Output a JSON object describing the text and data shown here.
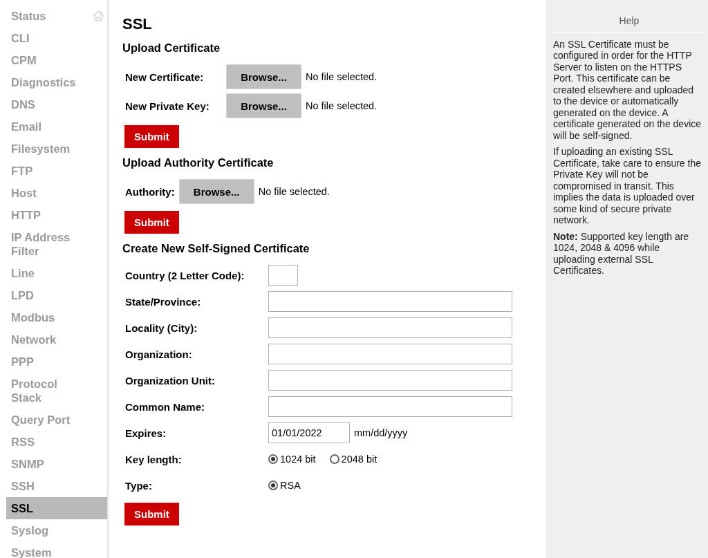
{
  "sidebar": {
    "items": [
      {
        "label": "Status",
        "selected": false
      },
      {
        "label": "CLI",
        "selected": false
      },
      {
        "label": "CPM",
        "selected": false
      },
      {
        "label": "Diagnostics",
        "selected": false
      },
      {
        "label": "DNS",
        "selected": false
      },
      {
        "label": "Email",
        "selected": false
      },
      {
        "label": "Filesystem",
        "selected": false
      },
      {
        "label": "FTP",
        "selected": false
      },
      {
        "label": "Host",
        "selected": false
      },
      {
        "label": "HTTP",
        "selected": false
      },
      {
        "label": "IP Address Filter",
        "selected": false
      },
      {
        "label": "Line",
        "selected": false
      },
      {
        "label": "LPD",
        "selected": false
      },
      {
        "label": "Modbus",
        "selected": false
      },
      {
        "label": "Network",
        "selected": false
      },
      {
        "label": "PPP",
        "selected": false
      },
      {
        "label": "Protocol Stack",
        "selected": false
      },
      {
        "label": "Query Port",
        "selected": false
      },
      {
        "label": "RSS",
        "selected": false
      },
      {
        "label": "SNMP",
        "selected": false
      },
      {
        "label": "SSH",
        "selected": false
      },
      {
        "label": "SSL",
        "selected": true
      },
      {
        "label": "Syslog",
        "selected": false
      },
      {
        "label": "System",
        "selected": false
      }
    ]
  },
  "page_title": "SSL",
  "sections": [
    {
      "heading": "Upload Certificate",
      "files": [
        {
          "label": "New Certificate:",
          "button": "Browse...",
          "status": "No file selected."
        },
        {
          "label": "New Private Key:",
          "button": "Browse...",
          "status": "No file selected."
        }
      ],
      "submit": "Submit"
    },
    {
      "heading": "Upload Authority Certificate",
      "files": [
        {
          "label": "Authority:",
          "button": "Browse...",
          "status": "No file selected."
        }
      ],
      "submit": "Submit"
    },
    {
      "heading": "Create New Self-Signed Certificate",
      "fields": [
        {
          "kind": "short",
          "label": "Country (2 Letter Code):"
        },
        {
          "kind": "text",
          "label": "State/Province:"
        },
        {
          "kind": "text",
          "label": "Locality (City):"
        },
        {
          "kind": "text",
          "label": "Organization:"
        },
        {
          "kind": "text",
          "label": "Organization Unit:"
        },
        {
          "kind": "text",
          "label": "Common Name:"
        },
        {
          "kind": "date",
          "label": "Expires:",
          "value": "01/01/2022",
          "hint": "mm/dd/yyyy"
        },
        {
          "kind": "radio",
          "label": "Key length:",
          "options": [
            {
              "label": "1024 bit",
              "selected": true
            },
            {
              "label": "2048 bit",
              "selected": false
            }
          ]
        },
        {
          "kind": "radio",
          "label": "Type:",
          "options": [
            {
              "label": "RSA",
              "selected": true
            }
          ]
        }
      ],
      "submit": "Submit"
    }
  ],
  "help": {
    "title": "Help",
    "paragraphs": [
      "An SSL Certificate must be configured in order for the HTTP Server to listen on the HTTPS Port. This certificate can be created elsewhere and uploaded to the device or automatically generated on the device. A certificate generated on the device will be self-signed.",
      "If uploading an existing SSL Certificate, take care to ensure the Private Key will not be compromised in transit. This implies the data is uploaded over some kind of secure private network.",
      "**Note:** Supported key length are 1024, 2048 & 4096 while uploading external SSL Certificates."
    ]
  }
}
